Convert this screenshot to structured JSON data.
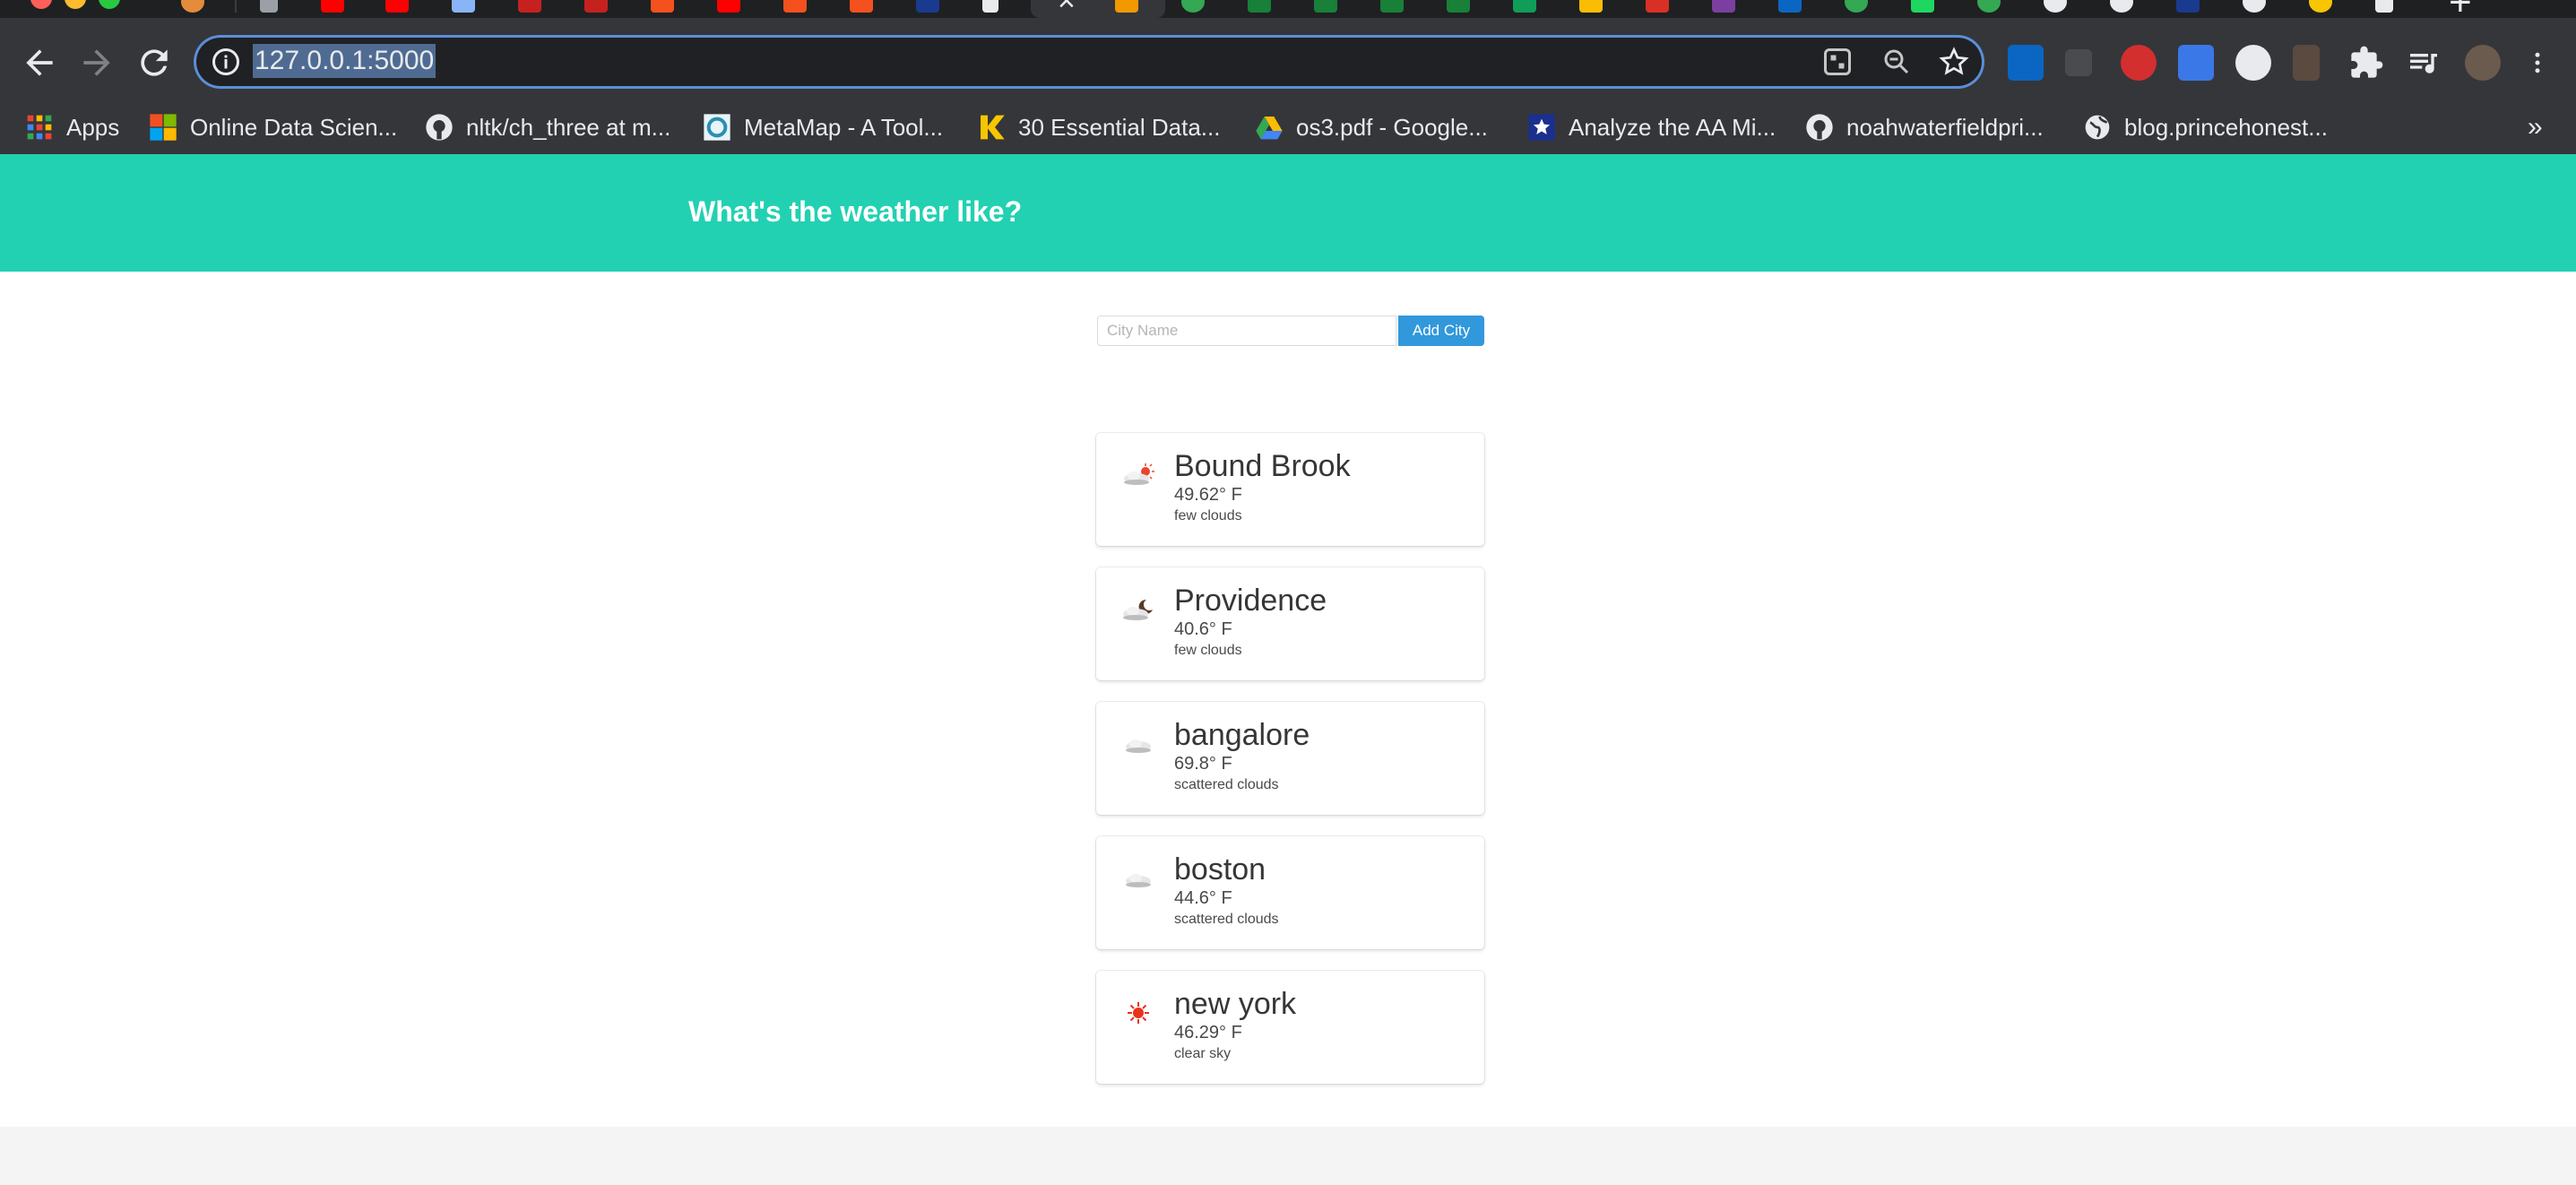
{
  "browser": {
    "url": "127.0.0.1:5000",
    "bookmarks": [
      {
        "label": "Apps",
        "icon": "apps-grid-icon"
      },
      {
        "label": "Online Data Scien...",
        "icon": "microsoft-icon"
      },
      {
        "label": "nltk/ch_three at m...",
        "icon": "github-icon"
      },
      {
        "label": "MetaMap - A Tool...",
        "icon": "metamap-icon"
      },
      {
        "label": "30 Essential Data...",
        "icon": "k-logo-icon"
      },
      {
        "label": "os3.pdf - Google...",
        "icon": "google-drive-icon"
      },
      {
        "label": "Analyze the AA Mi...",
        "icon": "star-badge-icon"
      },
      {
        "label": "noahwaterfieldpri...",
        "icon": "github-icon"
      },
      {
        "label": "blog.princehonest...",
        "icon": "globe-icon"
      }
    ],
    "bookmarks_more": "»",
    "new_tab": "+",
    "tab_close": "×"
  },
  "app": {
    "title": "What's the weather like?",
    "input_placeholder": "City Name",
    "input_value": "",
    "add_button": "Add City"
  },
  "cities": [
    {
      "name": "Bound Brook",
      "temp": "49.62° F",
      "desc": "few clouds",
      "icon": "few-clouds-icon"
    },
    {
      "name": "Providence",
      "temp": "40.6° F",
      "desc": "few clouds",
      "icon": "few-clouds-night-icon"
    },
    {
      "name": "bangalore",
      "temp": "69.8° F",
      "desc": "scattered clouds",
      "icon": "scattered-clouds-icon"
    },
    {
      "name": "boston",
      "temp": "44.6° F",
      "desc": "scattered clouds",
      "icon": "scattered-clouds-icon"
    },
    {
      "name": "new york",
      "temp": "46.29° F",
      "desc": "clear sky",
      "icon": "clear-sky-sun-icon"
    }
  ],
  "colors": {
    "hero": "#22d1b1",
    "button": "#3298dc",
    "toolbar": "#35363a",
    "tabstrip": "#1f2022"
  }
}
